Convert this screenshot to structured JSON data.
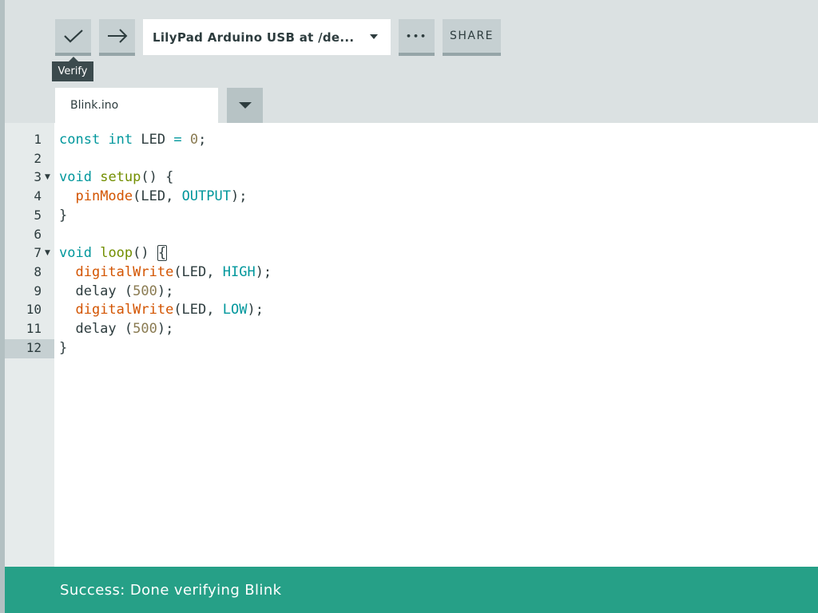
{
  "toolbar": {
    "verify_tooltip": "Verify",
    "board_label": "LilyPad Arduino USB at /de...",
    "more_label": "•••",
    "share_label": "SHARE"
  },
  "tabs": {
    "file_name": "Blink.ino"
  },
  "editor": {
    "active_line": 12,
    "line_numbers": [
      "1",
      "2",
      "3",
      "4",
      "5",
      "6",
      "7",
      "8",
      "9",
      "10",
      "11",
      "12"
    ],
    "lines": [
      [
        {
          "t": "const",
          "c": "kw"
        },
        {
          "t": " "
        },
        {
          "t": "int",
          "c": "kw"
        },
        {
          "t": " LED "
        },
        {
          "t": "=",
          "c": "kw"
        },
        {
          "t": " "
        },
        {
          "t": "0",
          "c": "num"
        },
        {
          "t": ";"
        }
      ],
      [],
      [
        {
          "t": "void",
          "c": "kw"
        },
        {
          "t": " "
        },
        {
          "t": "setup",
          "c": "fn2"
        },
        {
          "t": "() {"
        }
      ],
      [
        {
          "t": "  "
        },
        {
          "t": "pinMode",
          "c": "fn"
        },
        {
          "t": "(LED, "
        },
        {
          "t": "OUTPUT",
          "c": "const"
        },
        {
          "t": ");"
        }
      ],
      [
        {
          "t": "}"
        }
      ],
      [],
      [
        {
          "t": "void",
          "c": "kw"
        },
        {
          "t": " "
        },
        {
          "t": "loop",
          "c": "fn2"
        },
        {
          "t": "() "
        },
        {
          "t": "{",
          "c": "cursorbox"
        }
      ],
      [
        {
          "t": "  "
        },
        {
          "t": "digitalWrite",
          "c": "fn"
        },
        {
          "t": "(LED, "
        },
        {
          "t": "HIGH",
          "c": "const"
        },
        {
          "t": ");"
        }
      ],
      [
        {
          "t": "  delay ("
        },
        {
          "t": "500",
          "c": "num"
        },
        {
          "t": ");"
        }
      ],
      [
        {
          "t": "  "
        },
        {
          "t": "digitalWrite",
          "c": "fn"
        },
        {
          "t": "(LED, "
        },
        {
          "t": "LOW",
          "c": "const"
        },
        {
          "t": ");"
        }
      ],
      [
        {
          "t": "  delay ("
        },
        {
          "t": "500",
          "c": "num"
        },
        {
          "t": ");"
        }
      ],
      [
        {
          "t": "}"
        }
      ]
    ],
    "fold_marker": "▼"
  },
  "status": {
    "message": "Success: Done verifying Blink"
  }
}
